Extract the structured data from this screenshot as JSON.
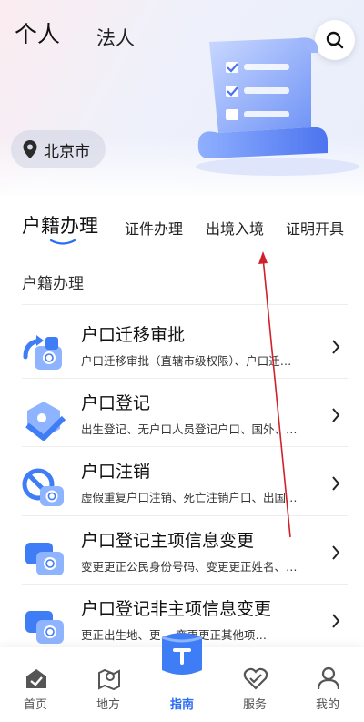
{
  "header": {
    "tab_personal": "个人",
    "tab_legal": "法人",
    "location": "北京市"
  },
  "categories": {
    "tabs": [
      "户籍办理",
      "证件办理",
      "出境入境",
      "证明开具"
    ],
    "active_index": 0
  },
  "section_title": "户籍办理",
  "items": [
    {
      "title": "户口迁移审批",
      "sub": "户口迁移审批（直辖市级权限）、户口迁…"
    },
    {
      "title": "户口登记",
      "sub": "出生登记、无户口人员登记户口、国外、…"
    },
    {
      "title": "户口注销",
      "sub": "虚假重复户口注销、死亡注销户口、出国…"
    },
    {
      "title": "户口登记主项信息变更",
      "sub": "变更更正公民身份号码、变更更正姓名、…"
    },
    {
      "title": "户口登记非主项信息变更",
      "sub": "更正出生地、更…        变更更正其他项…"
    }
  ],
  "bottom_nav": [
    {
      "label": "首页",
      "icon": "home-icon"
    },
    {
      "label": "地方",
      "icon": "map-icon"
    },
    {
      "label": "指南",
      "icon": "guide-icon"
    },
    {
      "label": "服务",
      "icon": "service-icon"
    },
    {
      "label": "我的",
      "icon": "user-icon"
    }
  ],
  "colors": {
    "accent": "#2a6df4",
    "annotation_arrow": "#d0202a",
    "icon_blue": "#3f7df6"
  }
}
